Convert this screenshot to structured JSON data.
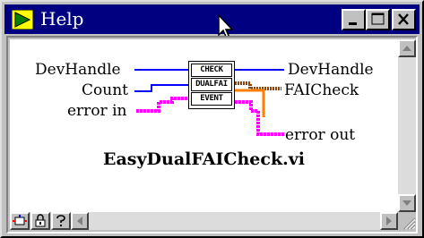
{
  "window": {
    "title": "Help",
    "buttons": {
      "minimize": "minimize",
      "maximize": "maximize",
      "close": "close"
    }
  },
  "diagram": {
    "inputs": {
      "dev_handle": "DevHandle",
      "count": "Count",
      "error_in": "error in"
    },
    "outputs": {
      "dev_handle": "DevHandle",
      "fai_check": "FAICheck",
      "error_out": "error out"
    },
    "icon_text": [
      "CHECK",
      "DUALFAI",
      "EVENT"
    ],
    "vi_name": "EasyDualFAICheck.vi",
    "wire_colors": {
      "dev_handle": "#0000ff",
      "count": "#0000ff",
      "error_cluster": "#ff00ff",
      "fai_check": "#8b4513",
      "orange": "#ff8000"
    }
  },
  "toolbar": {
    "icons": [
      "show-block-diagram-icon",
      "lock-icon",
      "help-question-icon"
    ]
  }
}
